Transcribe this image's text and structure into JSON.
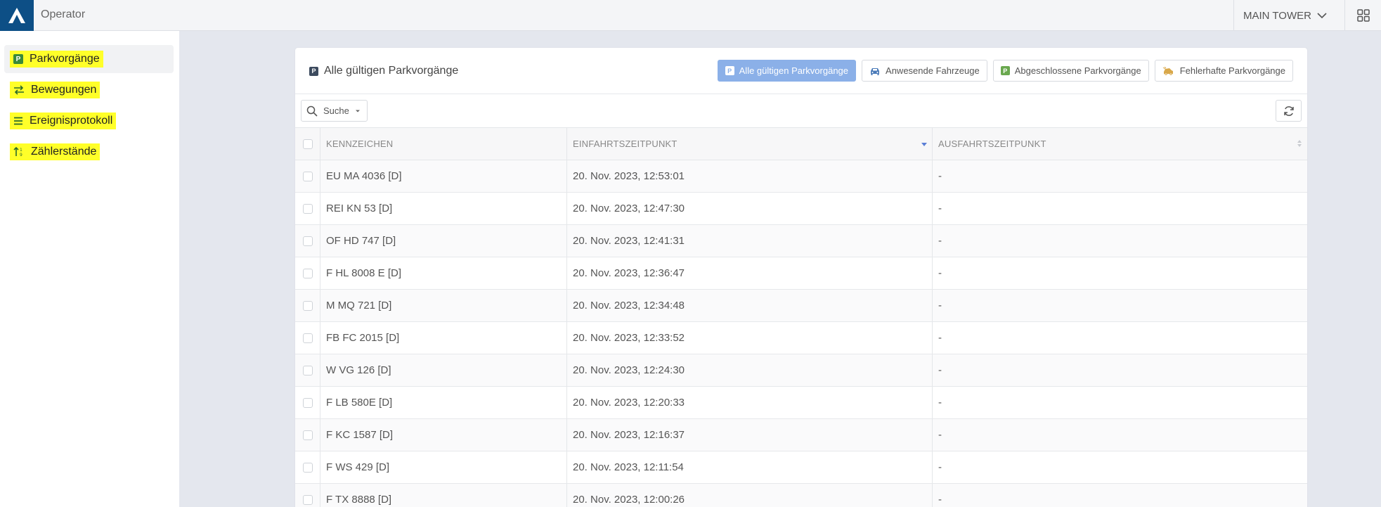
{
  "app": {
    "name": "Operator"
  },
  "header": {
    "location": "MAIN TOWER"
  },
  "sidebar": {
    "items": [
      {
        "label": "Parkvorgänge",
        "icon": "parking-icon",
        "active": true
      },
      {
        "label": "Bewegungen",
        "icon": "swap-arrows-icon",
        "active": false
      },
      {
        "label": "Ereignisprotokoll",
        "icon": "list-icon",
        "active": false
      },
      {
        "label": "Zählerstände",
        "icon": "sort-counter-icon",
        "active": false
      }
    ]
  },
  "main": {
    "title": "Alle gültigen Parkvorgänge",
    "filters": [
      {
        "label": "Alle gültigen Parkvorgänge",
        "active": true
      },
      {
        "label": "Anwesende Fahrzeuge",
        "active": false
      },
      {
        "label": "Abgeschlossene Parkvorgänge",
        "active": false
      },
      {
        "label": "Fehlerhafte Parkvorgänge",
        "active": false
      }
    ],
    "search_label": "Suche",
    "columns": [
      "KENNZEICHEN",
      "EINFAHRTSZEITPUNKT",
      "AUSFAHRTSZEITPUNKT"
    ],
    "rows": [
      {
        "plate": "EU MA 4036 [D]",
        "entry": "20. Nov. 2023, 12:53:01",
        "exit": "-"
      },
      {
        "plate": "REI KN 53 [D]",
        "entry": "20. Nov. 2023, 12:47:30",
        "exit": "-"
      },
      {
        "plate": "OF HD 747 [D]",
        "entry": "20. Nov. 2023, 12:41:31",
        "exit": "-"
      },
      {
        "plate": "F HL 8008 E [D]",
        "entry": "20. Nov. 2023, 12:36:47",
        "exit": "-"
      },
      {
        "plate": "M MQ 721 [D]",
        "entry": "20. Nov. 2023, 12:34:48",
        "exit": "-"
      },
      {
        "plate": "FB FC 2015 [D]",
        "entry": "20. Nov. 2023, 12:33:52",
        "exit": "-"
      },
      {
        "plate": "W VG 126 [D]",
        "entry": "20. Nov. 2023, 12:24:30",
        "exit": "-"
      },
      {
        "plate": "F LB 580E [D]",
        "entry": "20. Nov. 2023, 12:20:33",
        "exit": "-"
      },
      {
        "plate": "F KC 1587 [D]",
        "entry": "20. Nov. 2023, 12:16:37",
        "exit": "-"
      },
      {
        "plate": "F WS 429 [D]",
        "entry": "20. Nov. 2023, 12:11:54",
        "exit": "-"
      },
      {
        "plate": "F TX 8888 [D]",
        "entry": "20. Nov. 2023, 12:00:26",
        "exit": "-"
      }
    ]
  },
  "colors": {
    "brand": "#0d4f86",
    "active_filter": "#8bb0e8",
    "highlight": "#ffff29"
  }
}
